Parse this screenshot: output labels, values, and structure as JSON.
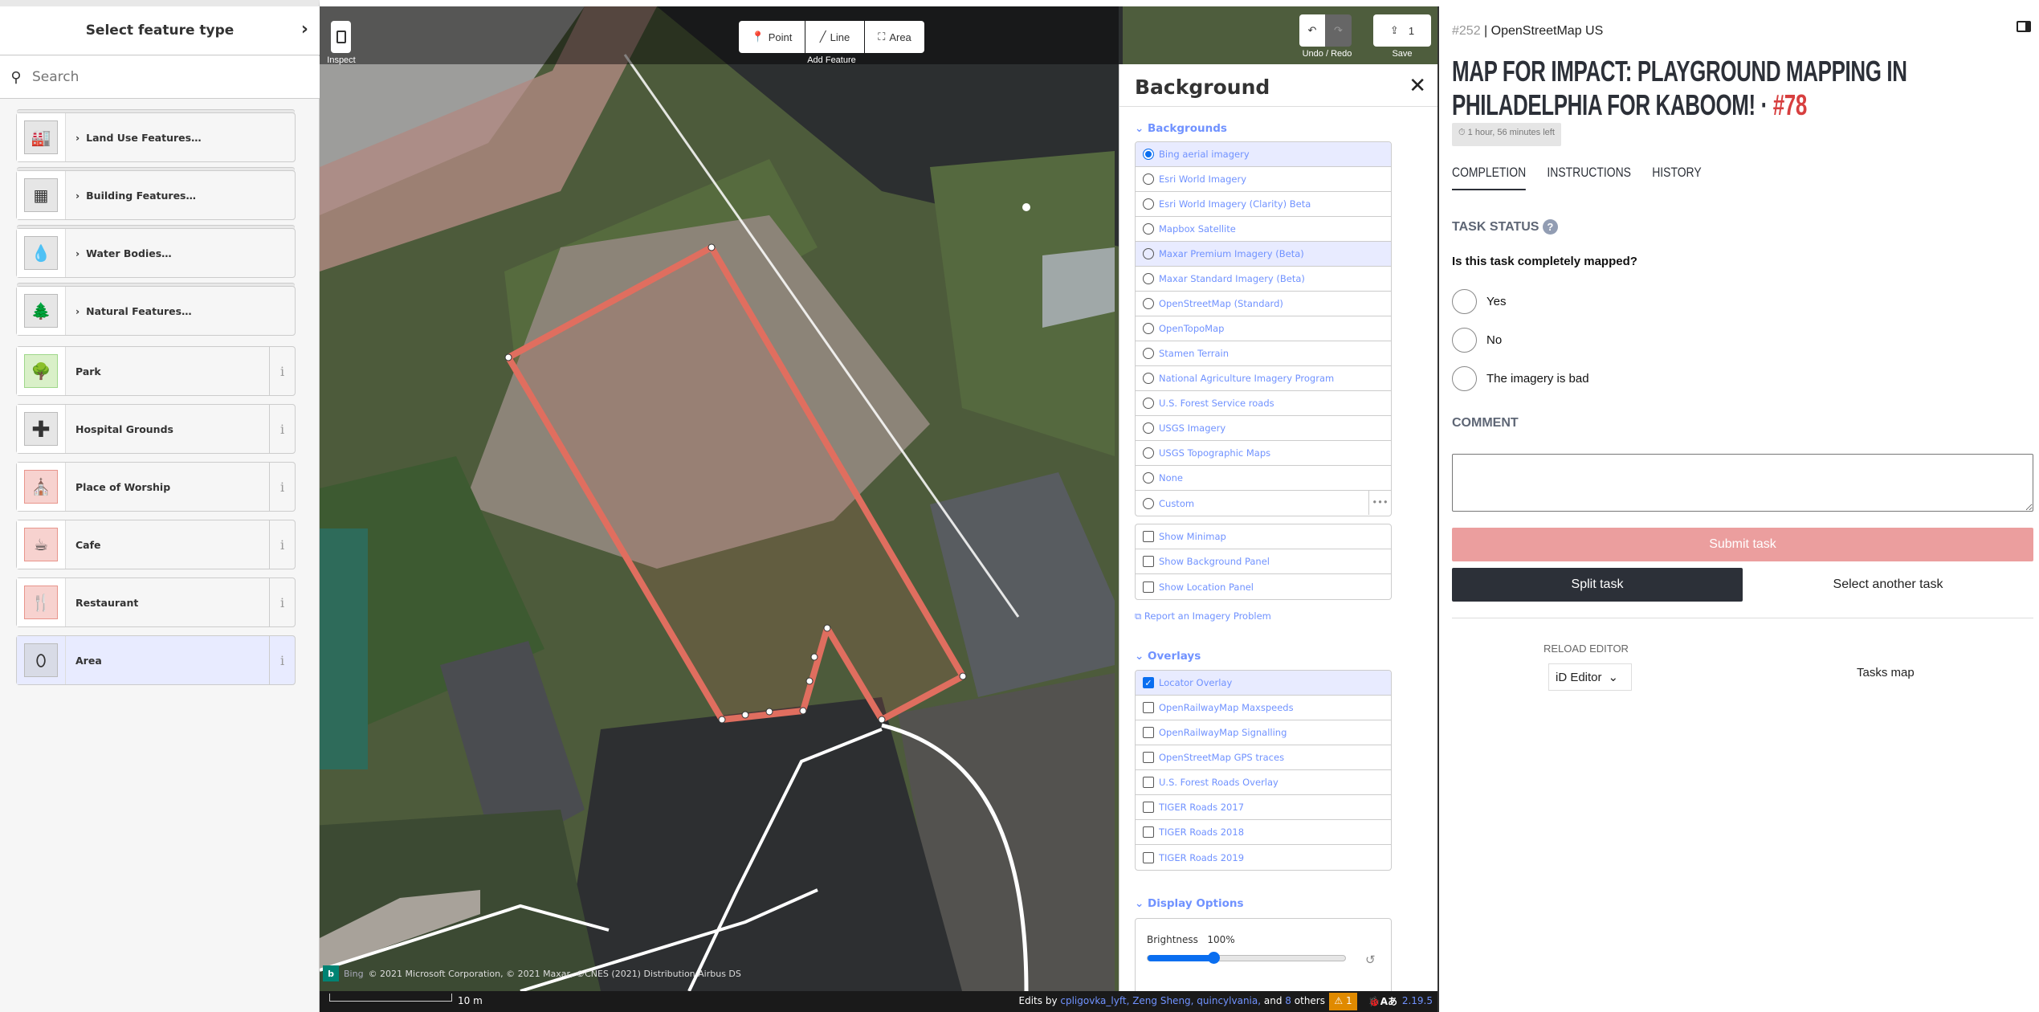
{
  "left_panel": {
    "title": "Select feature type",
    "search_placeholder": "Search",
    "categories": [
      {
        "label": "Land Use Features…",
        "icon": "landuse-icon"
      },
      {
        "label": "Building Features…",
        "icon": "building-icon"
      },
      {
        "label": "Water Bodies…",
        "icon": "water-drop-icon"
      },
      {
        "label": "Natural Features…",
        "icon": "nature-icon"
      }
    ],
    "presets": [
      {
        "label": "Park",
        "icon": "park-icon",
        "color": "#d9f0c8"
      },
      {
        "label": "Hospital Grounds",
        "icon": "hospital-icon",
        "color": "#e6e6e6"
      },
      {
        "label": "Place of Worship",
        "icon": "worship-icon",
        "color": "#f7d2cf"
      },
      {
        "label": "Cafe",
        "icon": "cafe-icon",
        "color": "#f7d2cf"
      },
      {
        "label": "Restaurant",
        "icon": "restaurant-icon",
        "color": "#f7d2cf"
      },
      {
        "label": "Area",
        "icon": "area-pin-icon",
        "color": "#d8dbe6",
        "selected": true
      }
    ]
  },
  "toolbar": {
    "inspect_label": "Inspect",
    "point": "Point",
    "line": "Line",
    "area": "Area",
    "add_feature_label": "Add Feature",
    "undo_redo_label": "Undo / Redo",
    "save_count": "1",
    "save_label": "Save"
  },
  "map": {
    "attribution_brand": "Bing",
    "attribution": "© 2021 Microsoft Corporation, © 2021 Maxar, ©CNES (2021) Distribution Airbus DS",
    "scale": "10 m",
    "edits_prefix": "Edits by",
    "editors": "cpligovka_lyft, Zeng Sheng, quincylvania,",
    "and": "and",
    "others_count": "8",
    "others": "others",
    "issues_count": "1",
    "version": "2.19.5",
    "area_color": "#e06e5f"
  },
  "background_panel": {
    "title": "Background",
    "backgrounds_heading": "Backgrounds",
    "backgrounds": [
      {
        "label": "Bing aerial imagery",
        "selected": true
      },
      {
        "label": "Esri World Imagery"
      },
      {
        "label": "Esri World Imagery (Clarity) Beta"
      },
      {
        "label": "Mapbox Satellite"
      },
      {
        "label": "Maxar Premium Imagery (Beta)",
        "hover": true
      },
      {
        "label": "Maxar Standard Imagery (Beta)"
      },
      {
        "label": "OpenStreetMap (Standard)"
      },
      {
        "label": "OpenTopoMap"
      },
      {
        "label": "Stamen Terrain"
      },
      {
        "label": "National Agriculture Imagery Program"
      },
      {
        "label": "U.S. Forest Service roads"
      },
      {
        "label": "USGS Imagery"
      },
      {
        "label": "USGS Topographic Maps"
      },
      {
        "label": "None"
      },
      {
        "label": "Custom"
      }
    ],
    "options": [
      "Show Minimap",
      "Show Background Panel",
      "Show Location Panel"
    ],
    "report_link": "Report an Imagery Problem",
    "overlays_heading": "Overlays",
    "overlays": [
      {
        "label": "Locator Overlay",
        "checked": true
      },
      {
        "label": "OpenRailwayMap Maxspeeds"
      },
      {
        "label": "OpenRailwayMap Signalling"
      },
      {
        "label": "OpenStreetMap GPS traces"
      },
      {
        "label": "U.S. Forest Roads Overlay"
      },
      {
        "label": "TIGER Roads 2017"
      },
      {
        "label": "TIGER Roads 2018"
      },
      {
        "label": "TIGER Roads 2019"
      }
    ],
    "display_heading": "Display Options",
    "brightness_label": "Brightness",
    "brightness_value": "100%",
    "brightness_fraction": 0.33
  },
  "task_panel": {
    "project_id": "#252",
    "organisation": "OpenStreetMap US",
    "title": "MAP FOR IMPACT: PLAYGROUND MAPPING IN PHILADELPHIA FOR KABOOM!",
    "separator": "·",
    "task_number": "#78",
    "time_left": "1 hour, 56 minutes left",
    "tabs": [
      "COMPLETION",
      "INSTRUCTIONS",
      "HISTORY"
    ],
    "active_tab": "COMPLETION",
    "task_status_heading": "TASK STATUS",
    "question": "Is this task completely mapped?",
    "options": [
      "Yes",
      "No",
      "The imagery is bad"
    ],
    "comment_heading": "COMMENT",
    "comment_value": "",
    "submit_label": "Submit task",
    "split_label": "Split task",
    "select_another_label": "Select another task",
    "reload_heading": "RELOAD EDITOR",
    "editor_selected": "iD Editor",
    "tasks_map_label": "Tasks map",
    "accent": "#d73f3f"
  }
}
